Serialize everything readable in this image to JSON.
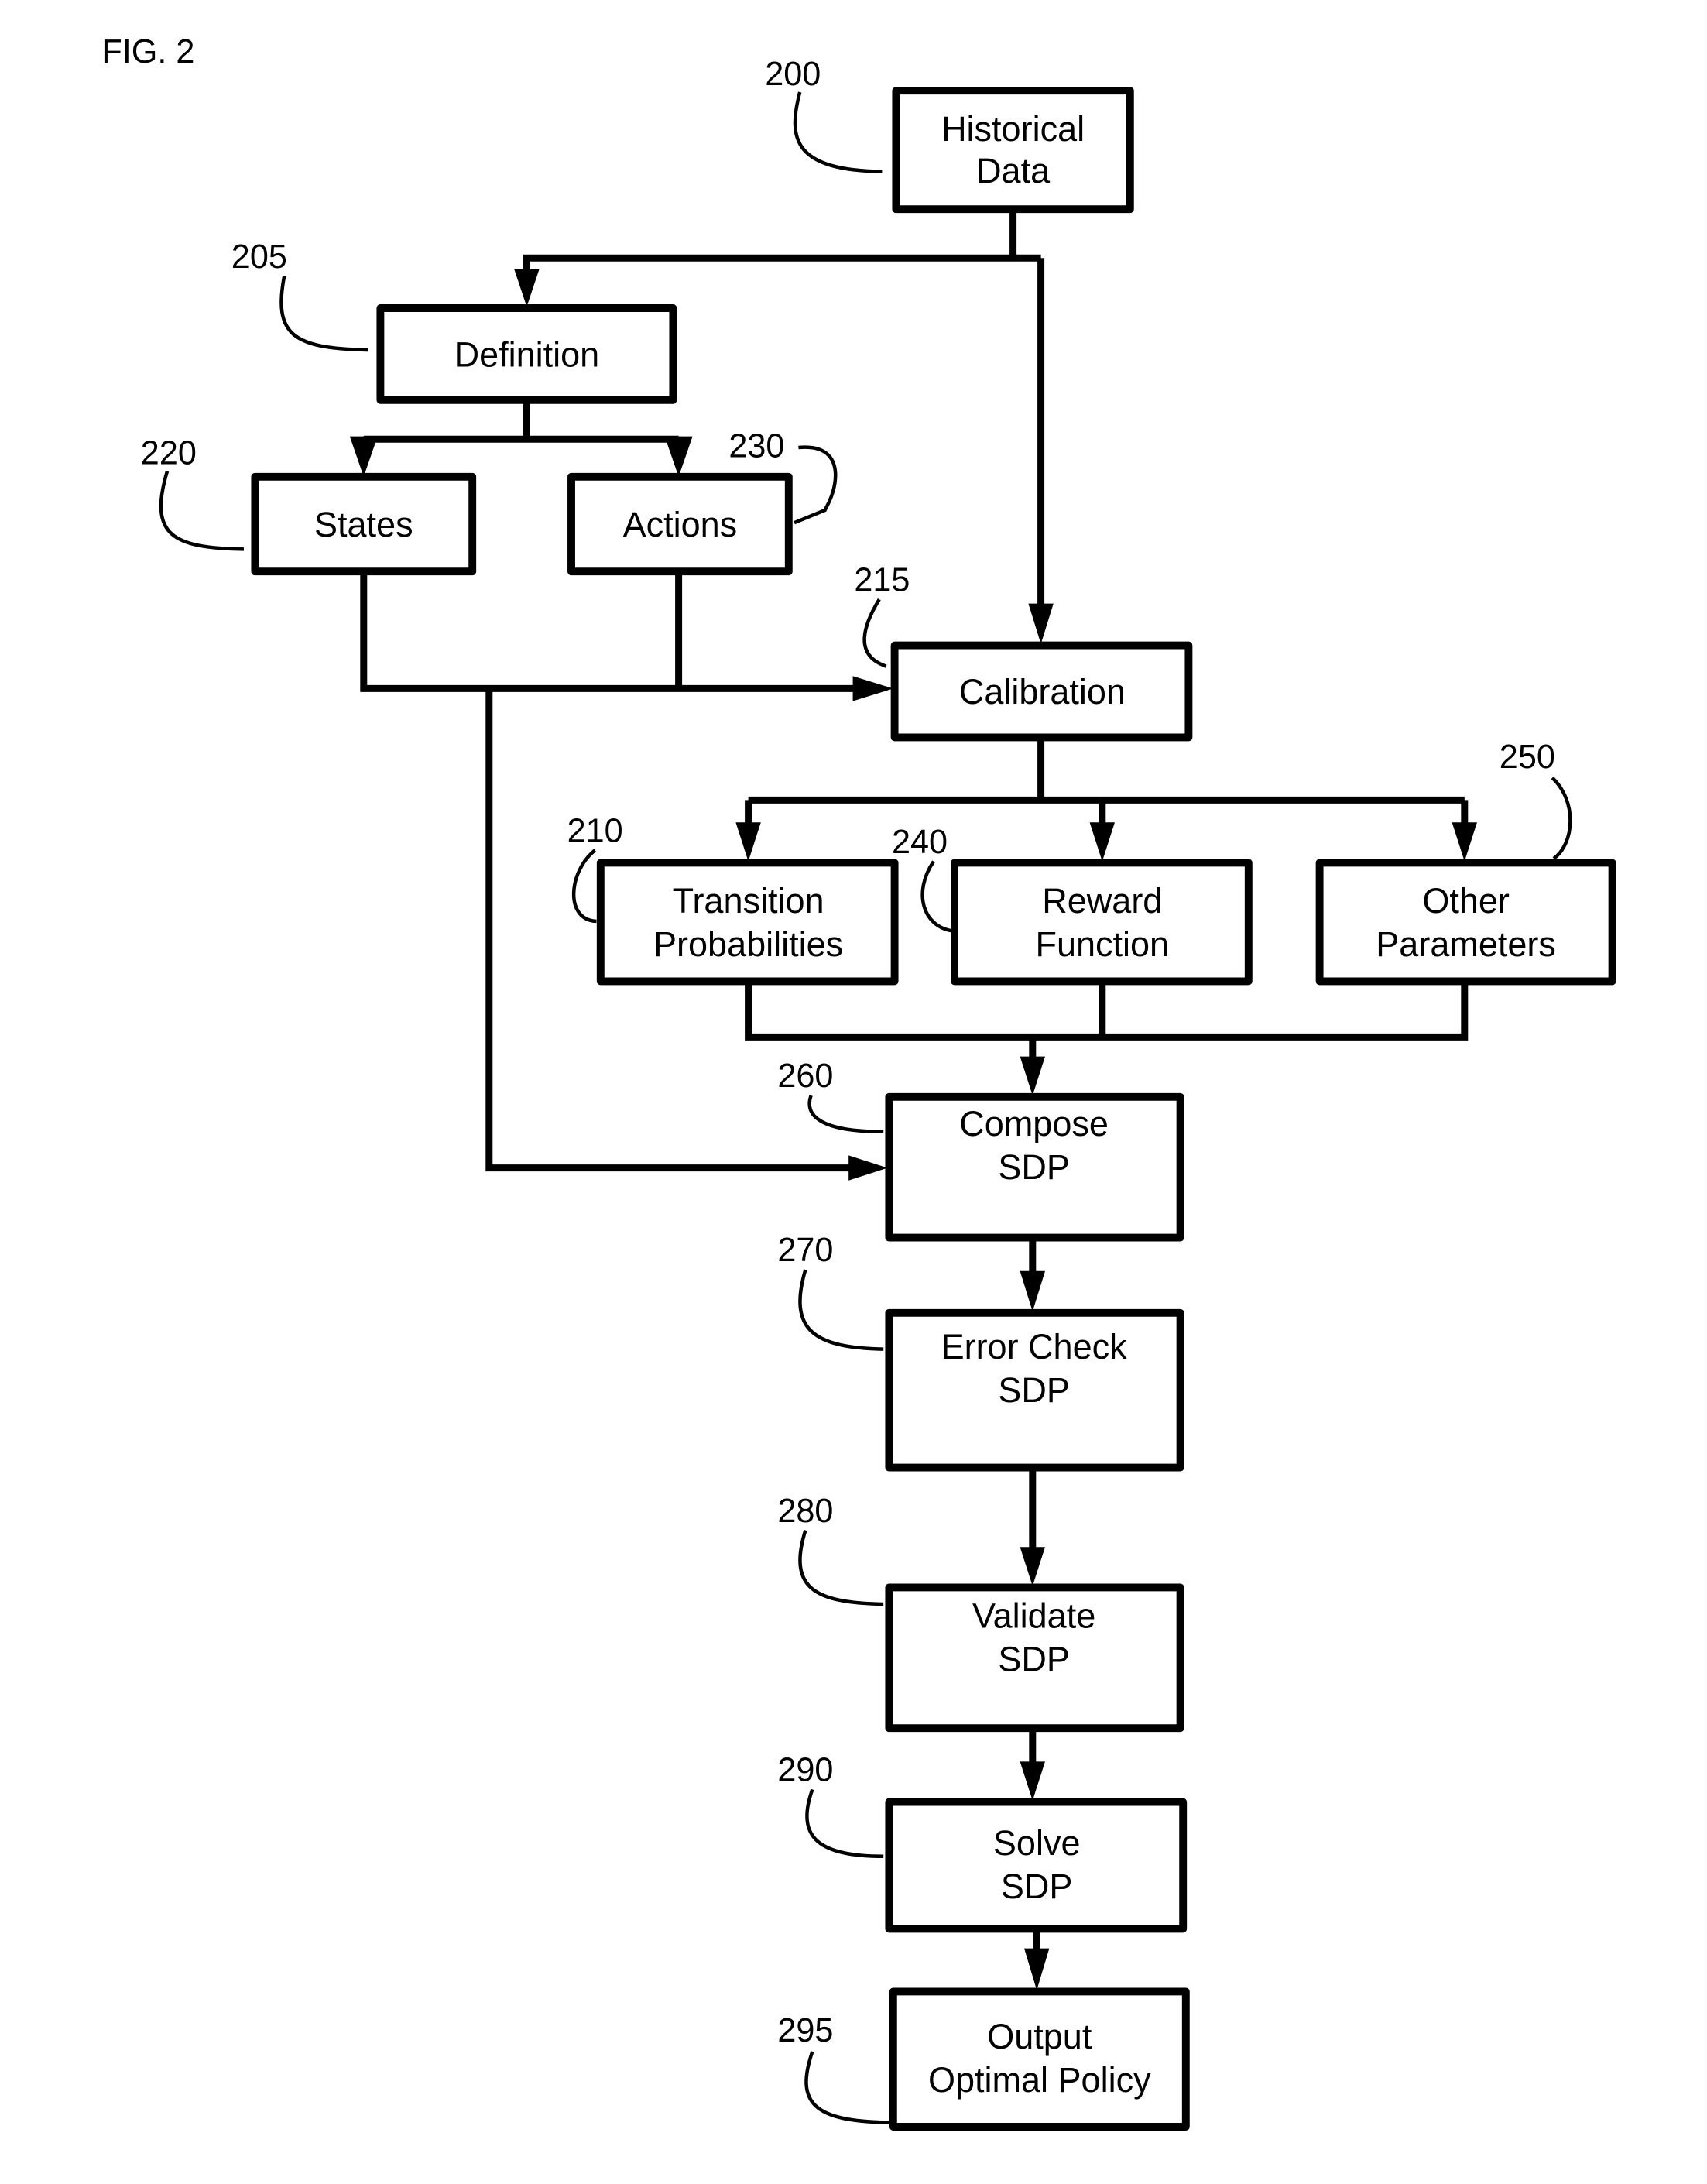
{
  "figure": {
    "label": "FIG. 2",
    "nodes": [
      {
        "id": "historical-data",
        "ref": "200",
        "lines": [
          "Historical",
          "Data"
        ]
      },
      {
        "id": "definition",
        "ref": "205",
        "lines": [
          "Definition"
        ]
      },
      {
        "id": "states",
        "ref": "220",
        "lines": [
          "States"
        ]
      },
      {
        "id": "actions",
        "ref": "230",
        "lines": [
          "Actions"
        ]
      },
      {
        "id": "calibration",
        "ref": "215",
        "lines": [
          "Calibration"
        ]
      },
      {
        "id": "transition-probabilities",
        "ref": "210",
        "lines": [
          "Transition",
          "Probabilities"
        ]
      },
      {
        "id": "reward-function",
        "ref": "240",
        "lines": [
          "Reward",
          "Function"
        ]
      },
      {
        "id": "other-parameters",
        "ref": "250",
        "lines": [
          "Other",
          "Parameters"
        ]
      },
      {
        "id": "compose-sdp",
        "ref": "260",
        "lines": [
          "Compose",
          "SDP"
        ]
      },
      {
        "id": "error-check-sdp",
        "ref": "270",
        "lines": [
          "Error Check",
          "SDP"
        ]
      },
      {
        "id": "validate-sdp",
        "ref": "280",
        "lines": [
          "Validate",
          "SDP"
        ]
      },
      {
        "id": "solve-sdp",
        "ref": "290",
        "lines": [
          "Solve",
          "SDP"
        ]
      },
      {
        "id": "output-optimal-policy",
        "ref": "295",
        "lines": [
          "Output",
          "Optimal Policy"
        ]
      }
    ],
    "edges": [
      {
        "from": "historical-data",
        "to": "definition"
      },
      {
        "from": "historical-data",
        "to": "calibration"
      },
      {
        "from": "definition",
        "to": "states"
      },
      {
        "from": "definition",
        "to": "actions"
      },
      {
        "from": "states",
        "to": "calibration"
      },
      {
        "from": "actions",
        "to": "calibration"
      },
      {
        "from": "states",
        "to": "compose-sdp"
      },
      {
        "from": "calibration",
        "to": "transition-probabilities"
      },
      {
        "from": "calibration",
        "to": "reward-function"
      },
      {
        "from": "calibration",
        "to": "other-parameters"
      },
      {
        "from": "transition-probabilities",
        "to": "compose-sdp"
      },
      {
        "from": "reward-function",
        "to": "compose-sdp"
      },
      {
        "from": "other-parameters",
        "to": "compose-sdp"
      },
      {
        "from": "compose-sdp",
        "to": "error-check-sdp"
      },
      {
        "from": "error-check-sdp",
        "to": "validate-sdp"
      },
      {
        "from": "validate-sdp",
        "to": "solve-sdp"
      },
      {
        "from": "solve-sdp",
        "to": "output-optimal-policy"
      }
    ]
  }
}
